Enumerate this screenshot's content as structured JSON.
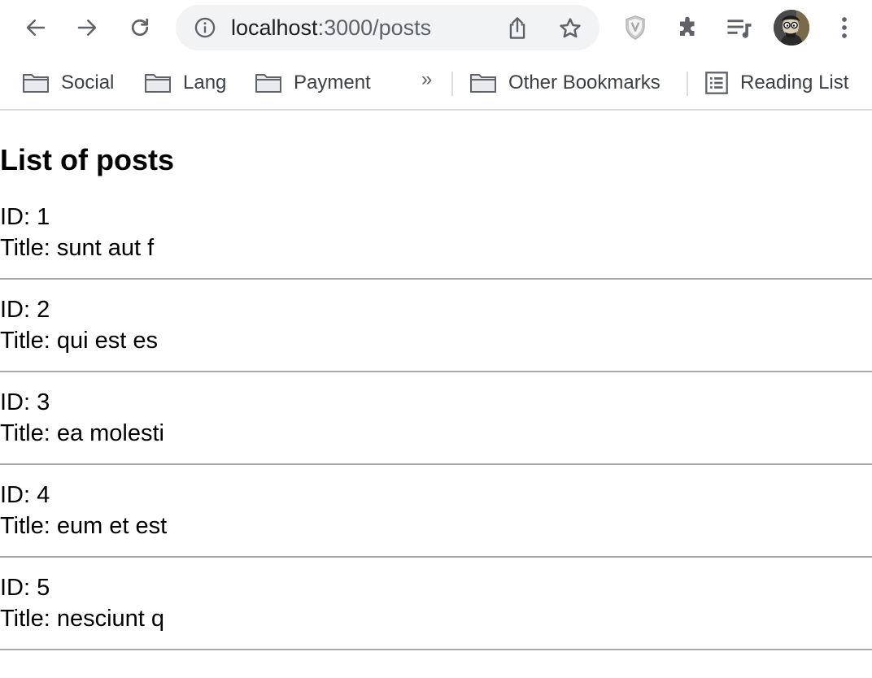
{
  "browser": {
    "url_host": "localhost",
    "url_path": ":3000/posts",
    "toolbar_icons": [
      "back-icon",
      "forward-icon",
      "reload-icon",
      "info-icon",
      "share-icon",
      "star-icon",
      "shield-extension-icon",
      "puzzle-extension-icon",
      "media-queue-icon",
      "avatar",
      "kebab-menu-icon"
    ]
  },
  "bookmarks": {
    "items": [
      {
        "label": "Social",
        "icon": "folder-icon"
      },
      {
        "label": "Lang",
        "icon": "folder-icon"
      },
      {
        "label": "Payment",
        "icon": "folder-icon"
      }
    ],
    "overflow": "»",
    "other": "Other Bookmarks",
    "reading_list": "Reading List"
  },
  "page": {
    "title": "List of posts",
    "posts": [
      {
        "id": "ID: 1",
        "title": "Title: sunt aut f"
      },
      {
        "id": "ID: 2",
        "title": "Title: qui est es"
      },
      {
        "id": "ID: 3",
        "title": "Title: ea molesti"
      },
      {
        "id": "ID: 4",
        "title": "Title: eum et est"
      },
      {
        "id": "ID: 5",
        "title": "Title: nesciunt q"
      }
    ]
  },
  "colors": {
    "omnibox_bg": "#f1f3f4",
    "separator": "#a9a9a9",
    "icon_gray": "#5f6368"
  }
}
